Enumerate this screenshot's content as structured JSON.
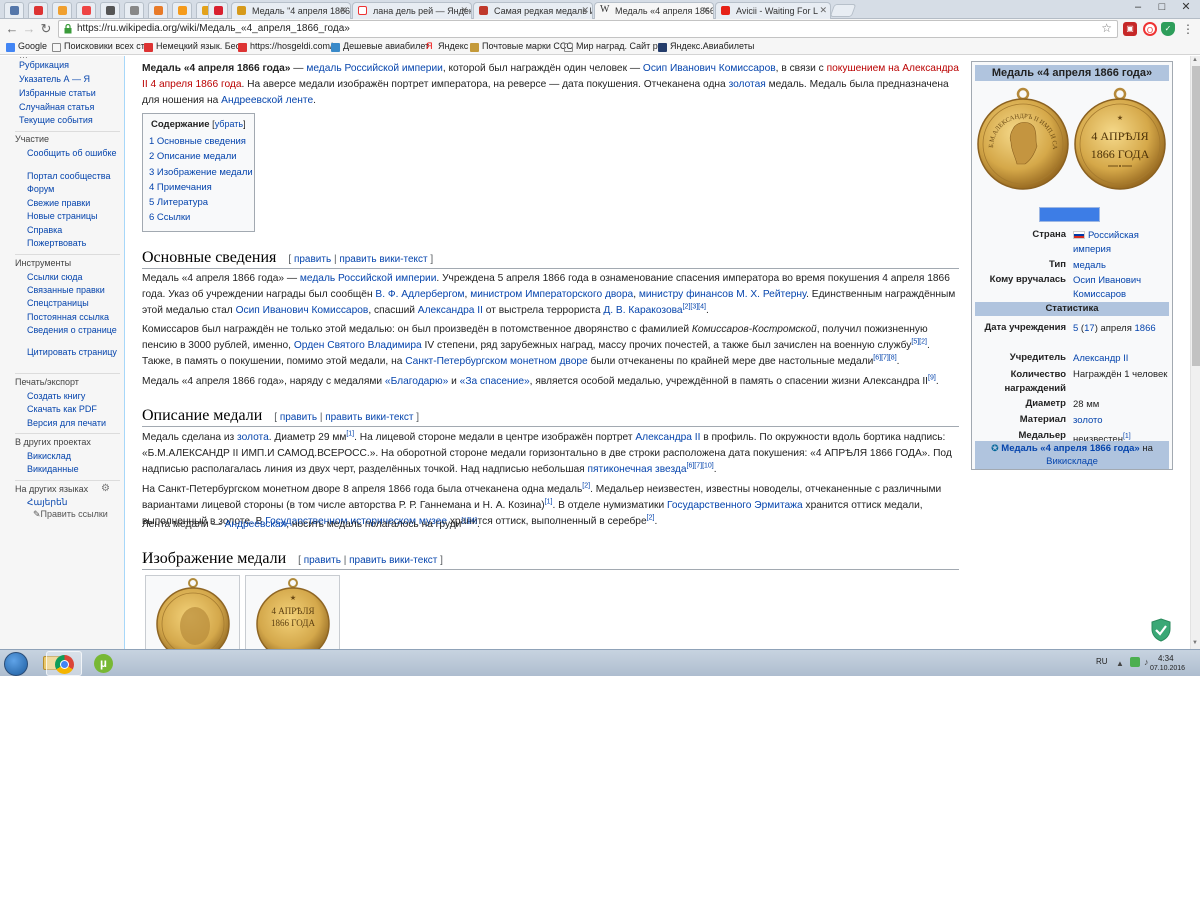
{
  "browser": {
    "tabs": [
      {
        "title": "Медаль \"4 апреля 1866",
        "fav": "#d69a1b"
      },
      {
        "title": "лана дель рей — Яндек",
        "fav": "#e33"
      },
      {
        "title": "Самая редкая медаль И",
        "fav": "#c0392b"
      },
      {
        "title": "Медаль «4 апреля 1866",
        "fav": "#ffffff",
        "glyph": "W"
      },
      {
        "title": "Avicii - Waiting For L",
        "fav": "#e62117"
      }
    ],
    "url": "https://ru.wikipedia.org/wiki/Медаль_«4_апреля_1866_года»",
    "bookmarks": [
      "Google",
      "Поисковики всех стр",
      "Немецкий язык. Бес",
      "https://hosgeldi.com/",
      "Дешевые авиабилет",
      "Яндекс",
      "Почтовые марки ССС",
      "Мир наград. Сайт ро",
      "Яндекс.Авиабилеты"
    ]
  },
  "sidebar": {
    "nav": [
      "Рубрикация",
      "Указатель А — Я",
      "Избранные статьи",
      "Случайная статья",
      "Текущие события"
    ],
    "participation": {
      "title": "Участие",
      "items": [
        "Сообщить об ошибке",
        "Портал сообщества",
        "Форум",
        "Свежие правки",
        "Новые страницы",
        "Справка",
        "Пожертвовать"
      ]
    },
    "tools": {
      "title": "Инструменты",
      "items": [
        "Ссылки сюда",
        "Связанные правки",
        "Спецстраницы",
        "Постоянная ссылка",
        "Сведения о странице",
        "Цитировать страницу"
      ]
    },
    "print": {
      "title": "Печать/экспорт",
      "items": [
        "Создать книгу",
        "Скачать как PDF",
        "Версия для печати"
      ]
    },
    "projects": {
      "title": "В других проектах",
      "items": [
        "Викисклад",
        "Викиданные"
      ]
    },
    "languages": {
      "title": "На других языках",
      "items": [
        "Հայերեն"
      ],
      "edit": "Править ссылки"
    }
  },
  "article": {
    "intro_title": "Медаль «4 апреля 1866 года»",
    "intro": [
      " — ",
      "медаль Российской империи",
      ", которой был награждён один человек — ",
      "Осип Иванович Комиссаров",
      ", в связи с ",
      "покушением на Александра II 4 апреля 1866 года",
      ". На аверсе медали изображён портрет императора, на реверсе — дата покушения. Отчеканена одна ",
      "золотая",
      " медаль. Медаль была предназначена для ношения на ",
      "Андреевской ленте",
      "."
    ],
    "toc": {
      "title": "Содержание",
      "toggle": "убрать",
      "items": [
        "1 Основные сведения",
        "2 Описание медали",
        "3 Изображение медали",
        "4 Примечания",
        "5 Литература",
        "6 Ссылки"
      ]
    },
    "edit_label": "править",
    "edit_source_label": "править вики-текст",
    "sections": {
      "basic": {
        "title": "Основные сведения",
        "p1": [
          "Медаль «4 апреля 1866 года» — ",
          "медаль Российской империи",
          ". Учреждена 5 апреля 1866 года в ознаменование спасения императора во время покушения 4 апреля 1866 года. Указ об учреждении награды был сообщён ",
          "В. Ф. Адлербергом",
          ", ",
          "министром Императорского двора",
          ", ",
          "министру финансов",
          " ",
          "М. Х. Рейтерну",
          ". Единственным награждённым этой медалью стал ",
          "Осип Иванович Комиссаров",
          ", спасший ",
          "Александра II",
          " от выстрела террориста ",
          "Д. В. Каракозова",
          "[2][3][4]",
          "."
        ],
        "p2": [
          "Комиссаров был награждён не только этой медалью: он был произведён в потомственное дворянство с фамилией ",
          "Комиссаров-Костромской",
          ", получил пожизненную пенсию в 3000 рублей, именно, ",
          "Орден Святого Владимира",
          " IV степени, ряд зарубежных наград, массу прочих почестей, а также был зачислен на военную службу",
          "[5][2]",
          ". Также, в память о покушении, помимо этой медали, на ",
          "Санкт-Петербургском монетном дворе",
          " были отчеканены по крайней мере две настольные медали",
          "[6][7][8]",
          "."
        ],
        "p3": [
          "Медаль «4 апреля 1866 года», наряду с медалями ",
          "«Благодарю»",
          " и ",
          "«За спасение»",
          ", является особой медалью, учреждённой в память о спасении жизни Александра II",
          "[9]",
          "."
        ]
      },
      "description": {
        "title": "Описание медали",
        "p1": [
          "Медаль сделана из ",
          "золота",
          ". Диаметр 29 мм",
          "[1]",
          ". На лицевой стороне медали в центре изображён портрет ",
          "Александра II",
          " в профиль. По окружности вдоль бортика надпись: «Б.М.АЛЕКСАНДР II ИМП.И САМОД.ВСЕРОСС.». На оборотной стороне медали горизонтально в две строки расположена дата покушения: «4 АПРѢЛЯ 1866 ГОДА». Под надписью располагалась линия из двух черт, разделённых точкой. Над надписью небольшая ",
          "пятиконечная звезда",
          "[6][7][10]",
          "."
        ],
        "p2": [
          "На Санкт-Петербургском монетном дворе 8 апреля 1866 года была отчеканена одна медаль",
          "[2]",
          ". Медальер неизвестен, известны новоделы, отчеканенные с различными вариантами лицевой стороны (в том числе авторства Р. Р. Ганнемана и Н. А. Козина)",
          "[1]",
          ". В отделе нумизматики ",
          "Государственного Эрмитажа",
          " хранится оттиск медали, выполненный в золоте. В ",
          "Государственном историческом музее",
          " хранится оттиск, выполненный в серебре",
          "[2]",
          "."
        ],
        "p3": [
          "Лента медали — ",
          "Андреевская",
          ", носить медаль полагалось на груди",
          "[1][4]",
          "."
        ]
      },
      "image": {
        "title": "Изображение медали"
      }
    }
  },
  "infobox": {
    "title": "Медаль «4 апреля 1866 года»",
    "obverse_legend": "Б.М.АЛЕКСАНДРЪ II ИМП.И САМОД.ВСЕРОСС.",
    "reverse_line1": "4 АПРѢЛЯ",
    "reverse_line2": "1866 ГОДА",
    "rows": [
      {
        "label": "Страна",
        "value": "Российская империя",
        "link": true
      },
      {
        "label": "Тип",
        "value": "медаль",
        "link": true
      },
      {
        "label": "Кому вручалась",
        "value": "Осип Иванович Комиссаров",
        "link": true
      }
    ],
    "stats_title": "Статистика",
    "stats": [
      {
        "label": "Дата учреждения",
        "value_link1": "5",
        "value_text1": " (",
        "value_link2": "17",
        "value_text2": ") апреля ",
        "value_link3": "1866"
      },
      {
        "label": "Учредитель",
        "value": "Александр II",
        "link": true
      },
      {
        "label": "Количество награждений",
        "value": "Награждён 1 человек",
        "link": false
      },
      {
        "label": "Диаметр",
        "value": "28 мм",
        "link": false
      },
      {
        "label": "Материал",
        "value": "золото",
        "link": true
      },
      {
        "label": "Медальер",
        "value": "неизвестен",
        "link": false,
        "sup": "[1]"
      }
    ],
    "commons_link": "Медаль «4 апреля 1866 года»",
    "commons_on": " на ",
    "commons_target": "Викискладе"
  },
  "taskbar": {
    "lang": "RU",
    "time": "4:34",
    "date": "07.10.2016"
  },
  "colors": {
    "link": "#0645ad",
    "redlink": "#ba0000",
    "gold": "#d4a84b",
    "infobox_header": "#b0c4de"
  }
}
